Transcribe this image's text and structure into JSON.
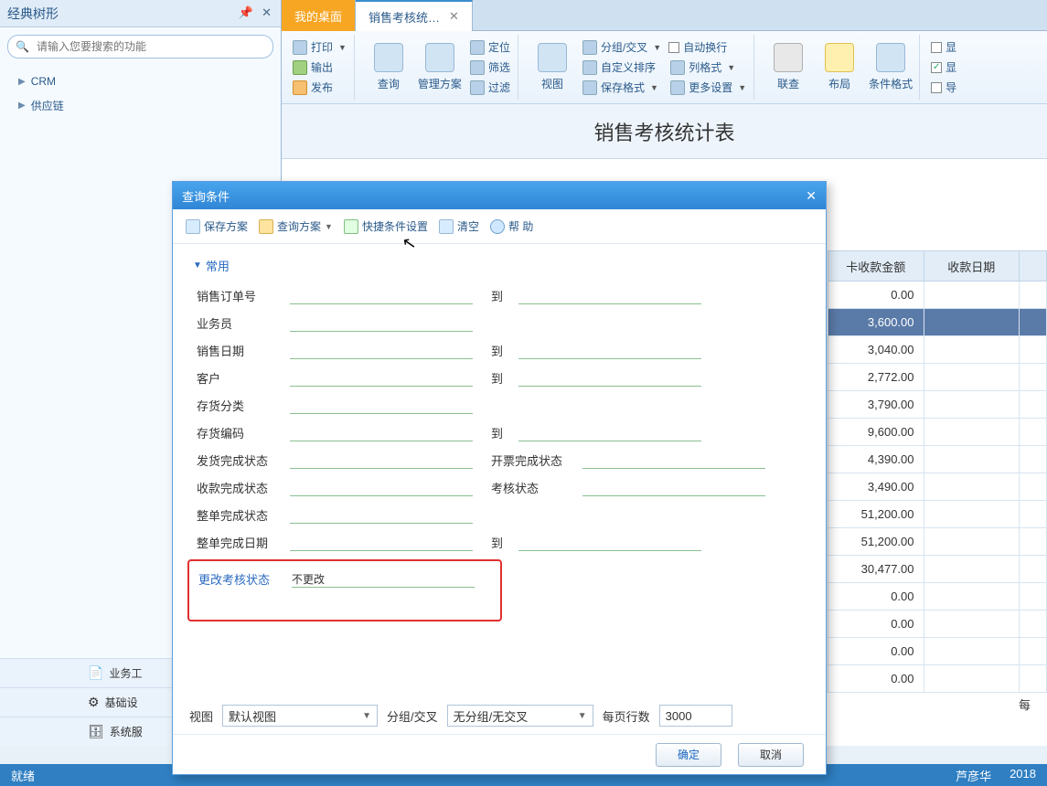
{
  "sidebar": {
    "title": "经典树形",
    "search_placeholder": "请输入您要搜索的功能",
    "tree": [
      {
        "label": "CRM"
      },
      {
        "label": "供应链"
      }
    ],
    "bottom": [
      {
        "label": "业务工",
        "name": "sidebar-biz"
      },
      {
        "label": "基础设",
        "name": "sidebar-basic"
      },
      {
        "label": "系统服",
        "name": "sidebar-system"
      }
    ]
  },
  "tabs": [
    {
      "label": "我的桌面",
      "kind": "home"
    },
    {
      "label": "销售考核统…",
      "kind": "active",
      "closable": true
    }
  ],
  "ribbon": {
    "col1": {
      "print": "打印",
      "export": "输出",
      "publish": "发布"
    },
    "large": {
      "query": "查询",
      "scheme": "管理方案",
      "view": "视图",
      "lookup": "联查",
      "layout": "布局",
      "condfmt": "条件格式"
    },
    "col2": {
      "locate": "定位",
      "filter": "筛选",
      "sift": "过滤"
    },
    "col3": {
      "group": "分组/交叉",
      "sort": "自定义排序",
      "savefmt": "保存格式"
    },
    "col4": {
      "autowrap": "自动换行",
      "colfmt": "列格式",
      "more": "更多设置"
    },
    "right1": "显",
    "right2": "显",
    "right3": "导"
  },
  "report_title": "销售考核统计表",
  "grid": {
    "headers": [
      "卡收款金额",
      "收款日期",
      ""
    ],
    "rows": [
      {
        "amount": "0.00"
      },
      {
        "amount": "3,600.00",
        "selected": true
      },
      {
        "amount": "3,040.00"
      },
      {
        "amount": "2,772.00"
      },
      {
        "amount": "3,790.00"
      },
      {
        "amount": "9,600.00"
      },
      {
        "amount": "4,390.00"
      },
      {
        "amount": "3,490.00"
      },
      {
        "amount": "51,200.00"
      },
      {
        "amount": "51,200.00"
      },
      {
        "amount": "30,477.00"
      },
      {
        "amount": "0.00"
      },
      {
        "amount": "0.00"
      },
      {
        "amount": "0.00"
      },
      {
        "amount": "0.00"
      }
    ],
    "footer_label": "每"
  },
  "dialog": {
    "title": "查询条件",
    "toolbar": {
      "save": "保存方案",
      "open": "查询方案",
      "quick": "快捷条件设置",
      "clear": "清空",
      "help": "帮 助"
    },
    "section": "常用",
    "fields": {
      "order_no": "销售订单号",
      "salesman": "业务员",
      "sale_date": "销售日期",
      "customer": "客户",
      "stock_cat": "存货分类",
      "stock_code": "存货编码",
      "ship_status": "发货完成状态",
      "invoice_status": "开票完成状态",
      "receipt_status": "收款完成状态",
      "assess_status": "考核状态",
      "whole_status": "整单完成状态",
      "whole_date": "整单完成日期",
      "change_assess": "更改考核状态",
      "to": "到"
    },
    "values": {
      "change_assess": "不更改"
    },
    "bottom": {
      "view_label": "视图",
      "view_value": "默认视图",
      "group_label": "分组/交叉",
      "group_value": "无分组/无交叉",
      "rows_label": "每页行数",
      "rows_value": "3000"
    },
    "buttons": {
      "ok": "确定",
      "cancel": "取消"
    }
  },
  "statusbar": {
    "left": "就绪",
    "user": "芦彦华",
    "year": "2018"
  }
}
